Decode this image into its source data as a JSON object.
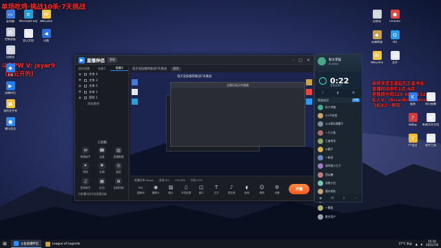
{
  "overlay": {
    "title": "单场吃鸡·挑战10杀·7天挑战",
    "left_line1": "斗鱼PW V: jxyar9",
    "left_line2": "(自云开的)",
    "right_lines": [
      "单排多双王者钻石王者冲水",
      "直播时间中午1点-4点",
      "老铁群号码125·0252232",
      "私人V：chuanfoddddoo55",
      "飞机X2一帮带"
    ]
  },
  "desktop_icons_left": [
    {
      "label": "此电脑",
      "color": "#3d7be0",
      "glyph": "▭"
    },
    {
      "label": "控制面板",
      "color": "#c8ccd4",
      "glyph": "▤"
    },
    {
      "label": "回收站",
      "color": "#cfd4da",
      "glyph": "◫"
    },
    {
      "label": "开始",
      "color": "#2d7ff0",
      "glyph": "◆"
    },
    {
      "label": "直播伴侣",
      "color": "#1e7ef5",
      "glyph": "▶"
    },
    {
      "label": "我的文件夹",
      "color": "#f0c23c",
      "glyph": "▣"
    },
    {
      "label": "腾讯会议",
      "color": "#2b8ef0",
      "glyph": "●"
    }
  ],
  "desktop_icons_top": [
    {
      "label": "Microsoft Edge",
      "color": "#1fa3d9",
      "glyph": "e"
    },
    {
      "label": "WeGame",
      "color": "#f5c542",
      "glyph": "W"
    },
    {
      "label": "金山文档",
      "color": "#e8eaee",
      "glyph": "▤"
    },
    {
      "label": "迅雷",
      "color": "#2b6ee0",
      "glyph": "◀"
    }
  ],
  "desktop_icons_right": [
    {
      "label": "回收站",
      "color": "#cfd4da",
      "glyph": "◫"
    },
    {
      "label": "英雄联盟",
      "color": "#c9a24a",
      "glyph": "◆"
    },
    {
      "label": "WeGame",
      "color": "#f5c542",
      "glyph": "W"
    },
    {
      "label": "Chrome",
      "color": "#e8453c",
      "glyph": "●"
    },
    {
      "label": "QQ",
      "color": "#2a9cf0",
      "glyph": "Q"
    },
    {
      "label": "文件",
      "color": "#e8eaee",
      "glyph": "▤"
    },
    {
      "label": "酷狗",
      "color": "#2e7df5",
      "glyph": "K"
    },
    {
      "label": "网易云",
      "color": "#d63a3a",
      "glyph": "♪"
    },
    {
      "label": "YY语音",
      "color": "#f0c030",
      "glyph": "Y"
    },
    {
      "label": "知识图集",
      "color": "#e8eaee",
      "glyph": "▤"
    },
    {
      "label": "新建文本文档",
      "color": "#e8eaee",
      "glyph": "▤"
    },
    {
      "label": "软件工具",
      "color": "#e8eaee",
      "glyph": "▤"
    }
  ],
  "app": {
    "name": "直播伴侣",
    "version": "更新",
    "toolbar_title": "电子竞技推荐挑战7天挑战",
    "toolbar_btn": "修改",
    "left_tabs": [
      "我的场景",
      "场景2",
      "场景3"
    ],
    "sources": [
      "文本 4",
      "文本 3",
      "文本 2",
      "文本 1",
      "游戏 1"
    ],
    "add_source": "添加素材",
    "tools_title": "工具箱",
    "tools": [
      {
        "label": "弹幕助手",
        "glyph": "✉"
      },
      {
        "label": "连麦",
        "glyph": "☎"
      },
      {
        "label": "直播数据",
        "glyph": "▥"
      },
      {
        "label": "特效",
        "glyph": "✦"
      },
      {
        "label": "礼物",
        "glyph": "❖"
      },
      {
        "label": "抽奖",
        "glyph": "◎"
      },
      {
        "label": "音效助手",
        "glyph": "♫"
      },
      {
        "label": "红包",
        "glyph": "▦"
      },
      {
        "label": "全屏控制",
        "glyph": "⊞"
      }
    ],
    "notice": "为直播时段开启直播功能",
    "nested_title": "电子竞技推荐挑战7天挑战",
    "dialog_title": "全屏后显示中画面",
    "status": [
      "直播码率:0kbps",
      "丢帧:0%",
      "CPU:8%",
      "内存:47%"
    ],
    "bottom_tools": [
      {
        "label": "直播间",
        "glyph": "▭"
      },
      {
        "label": "摄像头",
        "glyph": "◉"
      },
      {
        "label": "图片",
        "glyph": "▨"
      },
      {
        "label": "手机投屏",
        "glyph": "▯"
      },
      {
        "label": "窗口",
        "glyph": "◫"
      },
      {
        "label": "文字",
        "glyph": "T"
      },
      {
        "label": "麦克风",
        "glyph": "♪"
      },
      {
        "label": "音频",
        "glyph": "◖"
      },
      {
        "label": "美颜",
        "glyph": "☺"
      },
      {
        "label": "设置",
        "glyph": "⚙"
      }
    ],
    "go_live": "开播"
  },
  "voice": {
    "name": "秋大李猫",
    "sub": "ID:8884",
    "timer": "0:22",
    "timer_sub": "语音连接中",
    "section": "频道成员",
    "section_badge": "开黑",
    "members": [
      {
        "name": "秋大李猫",
        "color": "#4aa88a"
      },
      {
        "name": "小Y不吃鱼",
        "color": "#c9a26a"
      },
      {
        "name": "318宵风落樱子",
        "color": "#7e8da0"
      },
      {
        "name": "一只小鱼",
        "color": "#b06a6a"
      },
      {
        "name": "王者的风",
        "color": "#8fa86a"
      },
      {
        "name": "小橘子",
        "color": "#d9b04a"
      },
      {
        "name": "一碗汤",
        "color": "#6a86c0"
      },
      {
        "name": "请叫我小王子",
        "color": "#a07ac0"
      },
      {
        "name": "西瓜糖",
        "color": "#c07a7a"
      },
      {
        "name": "深夜小白",
        "color": "#7ac0b0"
      },
      {
        "name": "落叶知秋",
        "color": "#c0a07a"
      },
      {
        "name": "晚风吹来夏天",
        "color": "#8a9ab0"
      },
      {
        "name": "一颗星",
        "color": "#b0b06a"
      },
      {
        "name": "匿名用户",
        "color": "#9aa0a8"
      }
    ]
  },
  "taskbar": {
    "items": [
      {
        "label": "斗鱼直播伴侣",
        "color": "#2a8cff",
        "active": true
      },
      {
        "label": "League of Legends",
        "color": "#c9a24a",
        "active": false
      }
    ],
    "weather": "27°C 多云",
    "time": "15:10",
    "date": "2021/7/6"
  }
}
